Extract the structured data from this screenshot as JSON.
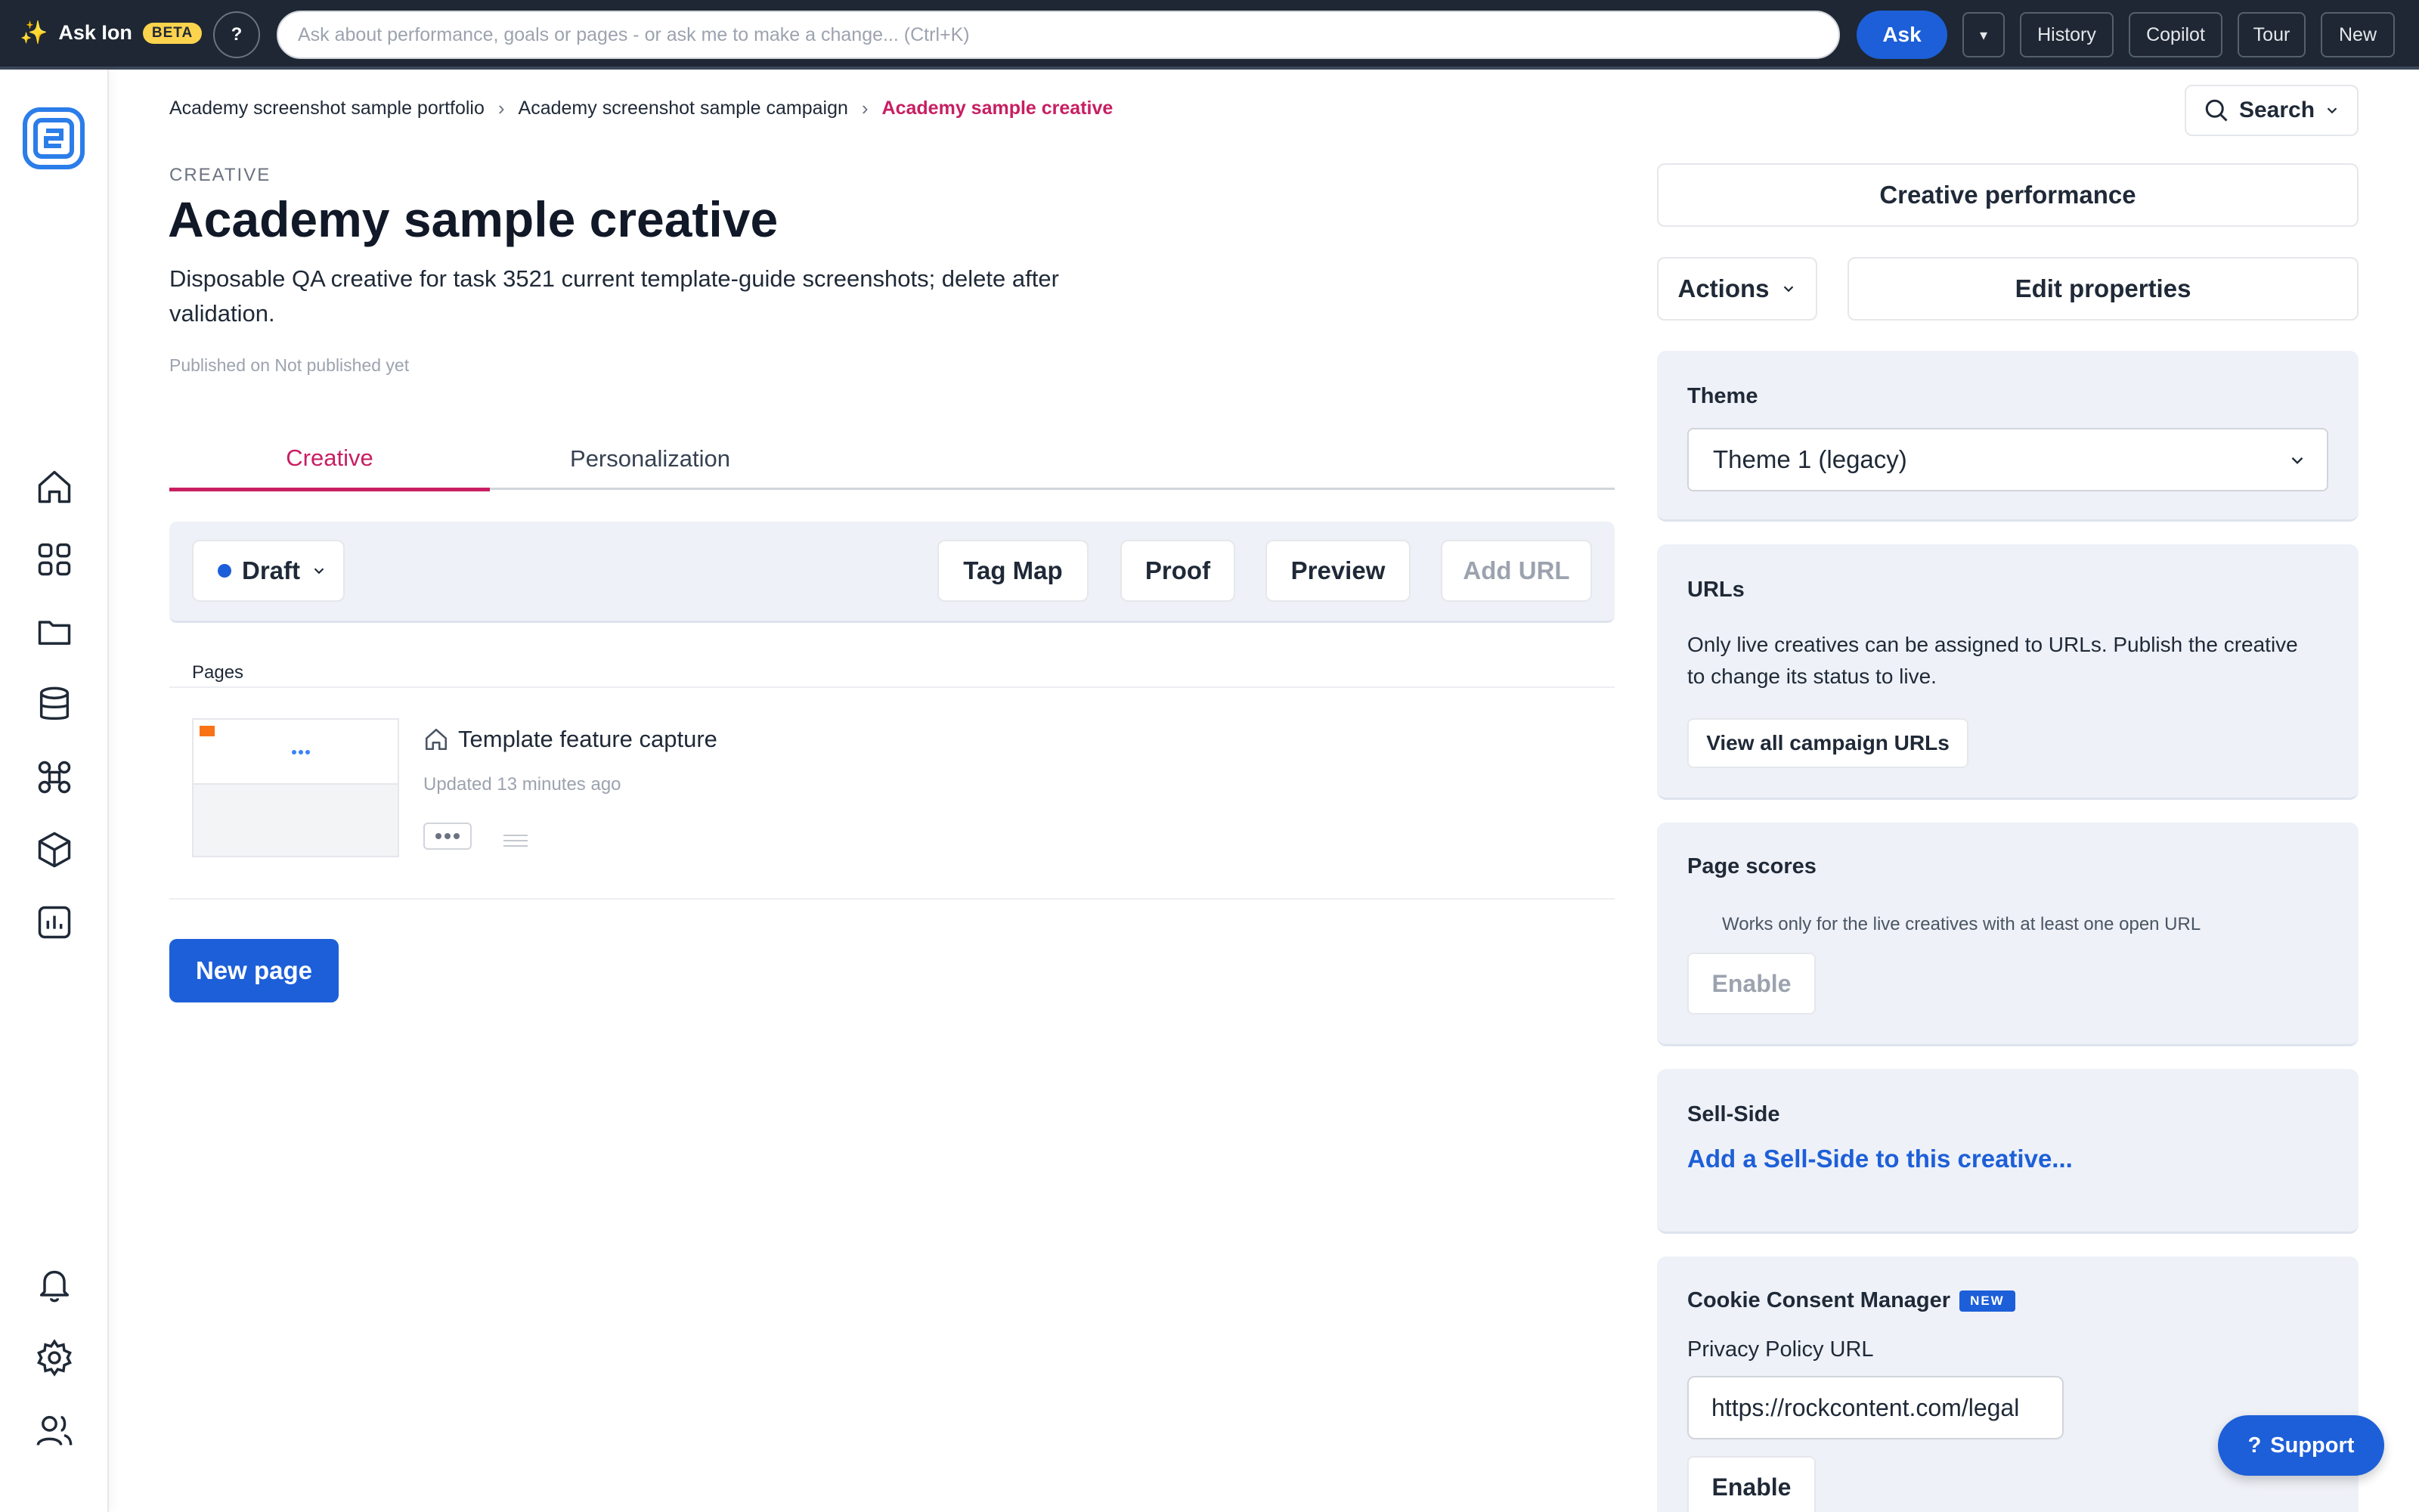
{
  "askbar": {
    "brand": "Ask Ion",
    "badge": "BETA",
    "help": "?",
    "placeholder": "Ask about performance, goals or pages - or ask me to make a change... (Ctrl+K)",
    "ask_label": "Ask",
    "dropdown": "▾",
    "buttons": [
      "History",
      "Copilot",
      "Tour",
      "New"
    ]
  },
  "breadcrumb": {
    "portfolio": "Academy screenshot sample portfolio",
    "campaign": "Academy screenshot sample campaign",
    "current": "Academy sample creative"
  },
  "search_label": "Search",
  "header": {
    "eyebrow": "CREATIVE",
    "title": "Academy sample creative",
    "description": "Disposable QA creative for task 3521 current template-guide screenshots; delete after validation.",
    "published": "Published on Not published yet"
  },
  "tabs": [
    {
      "label": "Creative",
      "active": true
    },
    {
      "label": "Personalization",
      "active": false
    }
  ],
  "toolbar": {
    "status": "Draft",
    "tag_map": "Tag Map",
    "proof": "Proof",
    "preview": "Preview",
    "add_url": "Add URL"
  },
  "pages": {
    "label": "Pages",
    "items": [
      {
        "name": "Template feature capture",
        "updated": "Updated 13 minutes ago"
      }
    ],
    "new_page": "New page"
  },
  "sidebar_right": {
    "creative_performance": "Creative performance",
    "actions": "Actions",
    "edit_properties": "Edit properties",
    "theme": {
      "title": "Theme",
      "selected": "Theme 1 (legacy)"
    },
    "urls": {
      "title": "URLs",
      "text": "Only live creatives can be assigned to URLs. Publish the creative to change its status to live.",
      "button": "View all campaign URLs"
    },
    "page_scores": {
      "title": "Page scores",
      "text": "Works only for the live creatives with at least one open URL",
      "button": "Enable"
    },
    "sell_side": {
      "title": "Sell-Side",
      "link": "Add a Sell-Side to this creative..."
    },
    "cookie": {
      "title": "Cookie Consent Manager",
      "badge": "NEW",
      "field_label": "Privacy Policy URL",
      "field_value": "https://rockcontent.com/legal",
      "button": "Enable"
    }
  },
  "support_label": "Support",
  "colors": {
    "accent": "#1d5fd8",
    "active_tab": "#c81e62",
    "topbar": "#1e2733",
    "card_bg": "#eef1f7"
  }
}
